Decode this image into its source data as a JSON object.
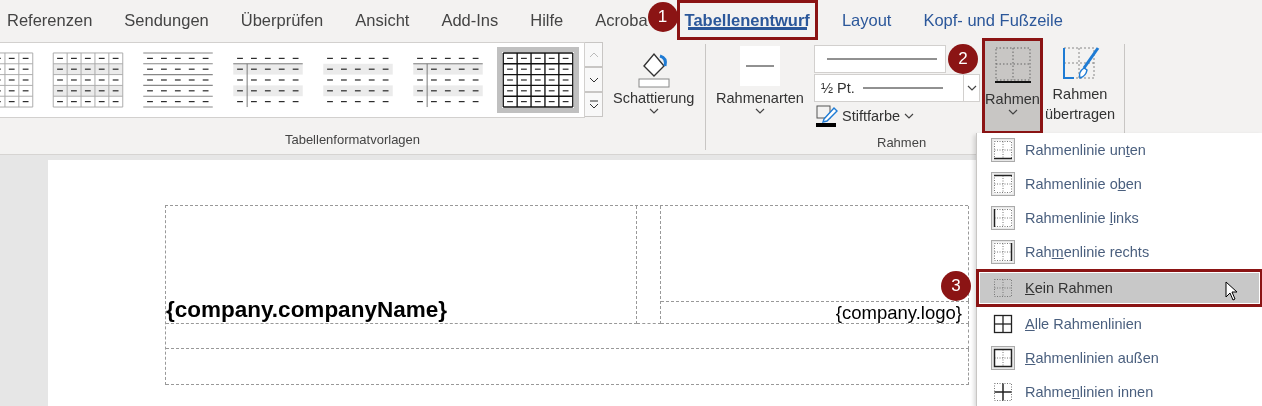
{
  "tabs": [
    {
      "label": "Referenzen",
      "selected": false,
      "contextual": false
    },
    {
      "label": "Sendungen",
      "selected": false,
      "contextual": false
    },
    {
      "label": "Überprüfen",
      "selected": false,
      "contextual": false
    },
    {
      "label": "Ansicht",
      "selected": false,
      "contextual": false
    },
    {
      "label": "Add-Ins",
      "selected": false,
      "contextual": false
    },
    {
      "label": "Hilfe",
      "selected": false,
      "contextual": false
    },
    {
      "label": "Acroba",
      "selected": false,
      "contextual": false
    },
    {
      "label": "Tabellenentwurf",
      "selected": true,
      "contextual": true,
      "callout": "1"
    },
    {
      "label": "Layout",
      "selected": false,
      "contextual": true
    },
    {
      "label": "Kopf- und Fußzeile",
      "selected": false,
      "contextual": true
    }
  ],
  "ribbon": {
    "table_styles": {
      "label": "Tabellenformatvorlagen",
      "items": [
        {
          "kind": "grid",
          "selected": false
        },
        {
          "kind": "grid-shaded",
          "selected": false
        },
        {
          "kind": "horizontal-lines",
          "selected": false
        },
        {
          "kind": "header-column",
          "selected": false
        },
        {
          "kind": "banded",
          "selected": false
        },
        {
          "kind": "header-column",
          "selected": false
        },
        {
          "kind": "grid-bold",
          "selected": true
        }
      ]
    },
    "shading": {
      "label": "Schattierung"
    },
    "borders_group": {
      "label": "Rahmen",
      "border_styles": {
        "label": "Rahmenarten"
      },
      "line_weight": "½ Pt.",
      "pen_color": {
        "label": "Stiftfarbe"
      },
      "borders_button": {
        "label": "Rahmen",
        "pressed": true,
        "callout": "2"
      },
      "border_painter": {
        "label": "Rahmen übertragen"
      }
    }
  },
  "document": {
    "company_name": "{company.companyName}",
    "company_logo": "{company.logo}"
  },
  "border_menu": {
    "items": [
      {
        "kind": "bottom",
        "label_before": "Rahmenlinie un",
        "access_key": "t",
        "label_after": "en",
        "selected": false
      },
      {
        "kind": "top",
        "label_before": "Rahmenlinie o",
        "access_key": "b",
        "label_after": "en",
        "selected": false
      },
      {
        "kind": "left",
        "label_before": "Rahmenlinie ",
        "access_key": "l",
        "label_after": "inks",
        "selected": false
      },
      {
        "kind": "right",
        "label_before": "Rah",
        "access_key": "m",
        "label_after": "enlinie rechts",
        "selected": false
      },
      {
        "kind": "none",
        "access_key": "K",
        "label_after": "ein Rahmen",
        "selected": true,
        "callout": "3"
      },
      {
        "kind": "all",
        "access_key": "A",
        "label_after": "lle Rahmenlinien",
        "selected": false
      },
      {
        "kind": "outside",
        "access_key": "R",
        "label_after": "ahmenlinien außen",
        "selected": false
      },
      {
        "kind": "inside",
        "label_before": "Rahme",
        "access_key": "n",
        "label_after": "linien innen",
        "selected": false
      }
    ]
  }
}
